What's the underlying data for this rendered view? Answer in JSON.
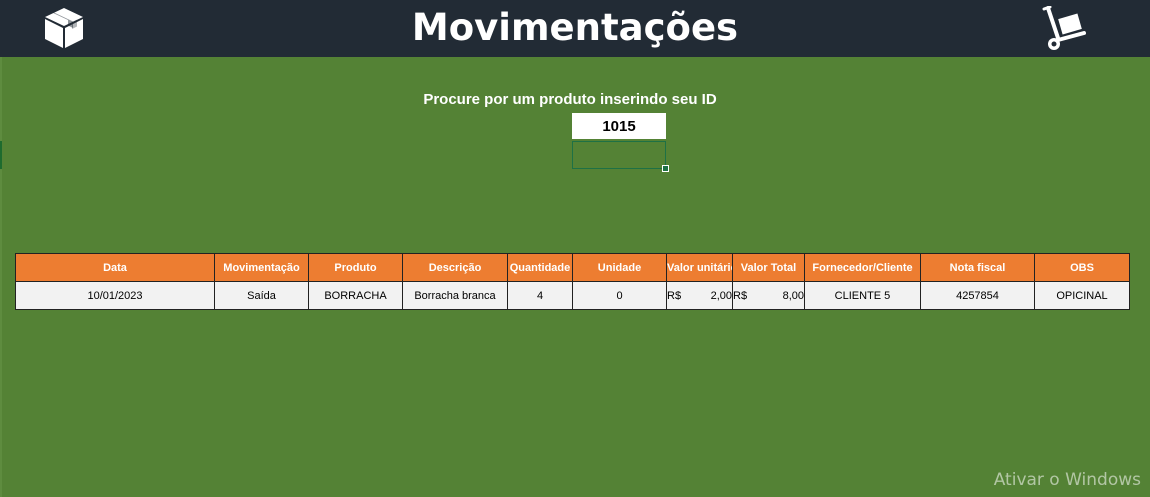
{
  "header": {
    "title": "Movimentações",
    "left_icon": "package-box-icon",
    "right_icon": "hand-truck-icon",
    "background": "#222b35"
  },
  "search": {
    "label": "Procure por um produto inserindo seu ID",
    "value": "1015"
  },
  "table": {
    "header_color": "#ed7d31",
    "columns": [
      "Data",
      "Movimentação",
      "Produto",
      "Descrição",
      "Quantidade",
      "Unidade",
      "Valor unitário",
      "Valor Total",
      "Fornecedor/Cliente",
      "Nota fiscal",
      "OBS"
    ],
    "row": {
      "data": "10/01/2023",
      "movimentacao": "Saída",
      "produto": "BORRACHA",
      "descricao": "Borracha branca",
      "quantidade": "4",
      "unidade": "0",
      "valor_unitario_cur": "R$",
      "valor_unitario": "2,00",
      "valor_total_cur": "R$",
      "valor_total": "8,00",
      "fornecedor": "CLIENTE 5",
      "nota_fiscal": "4257854",
      "obs": "OPICINAL"
    }
  },
  "watermark": "Ativar o Windows",
  "colors": {
    "background": "#548235",
    "accent": "#ed7d31"
  }
}
